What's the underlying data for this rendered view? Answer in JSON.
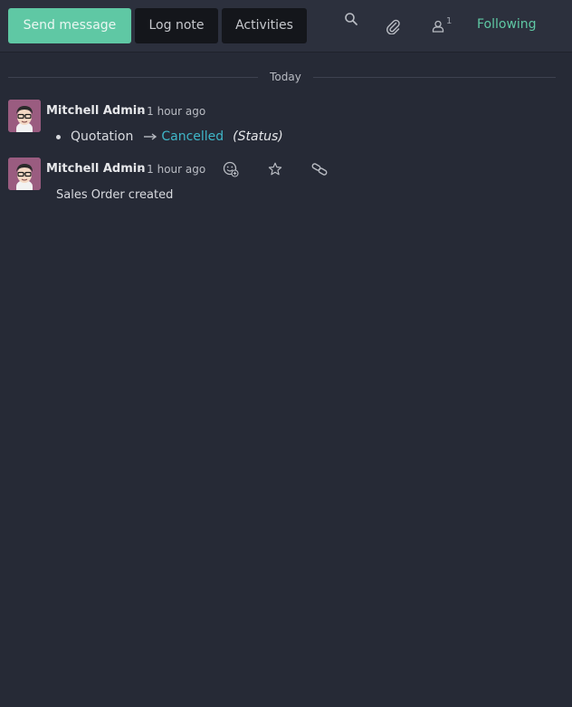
{
  "topbar": {
    "send_message": "Send message",
    "log_note": "Log note",
    "activities": "Activities",
    "follower_count": "1",
    "following": "Following",
    "icons": [
      "search-icon",
      "paperclip-icon",
      "user-icon"
    ]
  },
  "thread": {
    "date_separator": "Today",
    "messages": [
      {
        "author": "Mitchell Admin",
        "date": "- 1 hour ago",
        "tracking": {
          "field": "Quotation",
          "new_value": "Cancelled",
          "field_name": "(Status)"
        }
      },
      {
        "author": "Mitchell Admin",
        "date": "- 1 hour ago",
        "body": "Sales Order created",
        "actions": [
          "add-reaction-icon",
          "star-icon",
          "link-icon"
        ]
      }
    ]
  },
  "colors": {
    "accent": "#5fc8a4",
    "link": "#3fb6c8",
    "background": "#262a36"
  }
}
